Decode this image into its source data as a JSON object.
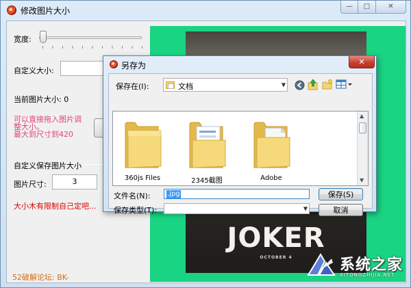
{
  "main_window": {
    "title": "修改图片大小",
    "caption_buttons": {
      "minimize": "—",
      "maximize": "□",
      "close": "✕"
    },
    "width_label": "宽度:",
    "custom_size_label": "自定义大小:",
    "custom_size_value": "",
    "current_size_label": "当前图片大小: 0",
    "hint_lines": [
      "可以直接拖入图片调",
      "整大小。",
      "最大到尺寸到420"
    ],
    "save_group_label": "自定义保存图片大小",
    "image_size_label": "图片尺寸:",
    "image_size_value": "3",
    "red_note": "大小木有限制自己定吧...",
    "footer_credit": "52破解论坛:   BK-"
  },
  "preview": {
    "poster_title": "JOKER",
    "poster_subtitle": "OCTOBER 4"
  },
  "save_dialog": {
    "title": "另存为",
    "close_glyph": "✕",
    "save_in_label": "保存在(I):",
    "save_in_value": "文档",
    "folders": [
      {
        "name": "360js Files",
        "variant": "plain"
      },
      {
        "name": "2345截图",
        "variant": "papers"
      },
      {
        "name": "Adobe",
        "variant": "document"
      }
    ],
    "filename_label": "文件名(N):",
    "filename_value": ".jpg",
    "filetype_label": "保存类型(T):",
    "filetype_value": "",
    "save_button": "保存(S)",
    "cancel_button": "取消"
  },
  "watermark": {
    "text": "系统之家",
    "sub": "XITONGZHIJIA.NET"
  },
  "colors": {
    "preview_bg": "#19d483",
    "hint_pink": "#e0457b",
    "note_red": "#e00000",
    "footer_orange": "#d66a12",
    "selection_blue": "#3399ff"
  }
}
